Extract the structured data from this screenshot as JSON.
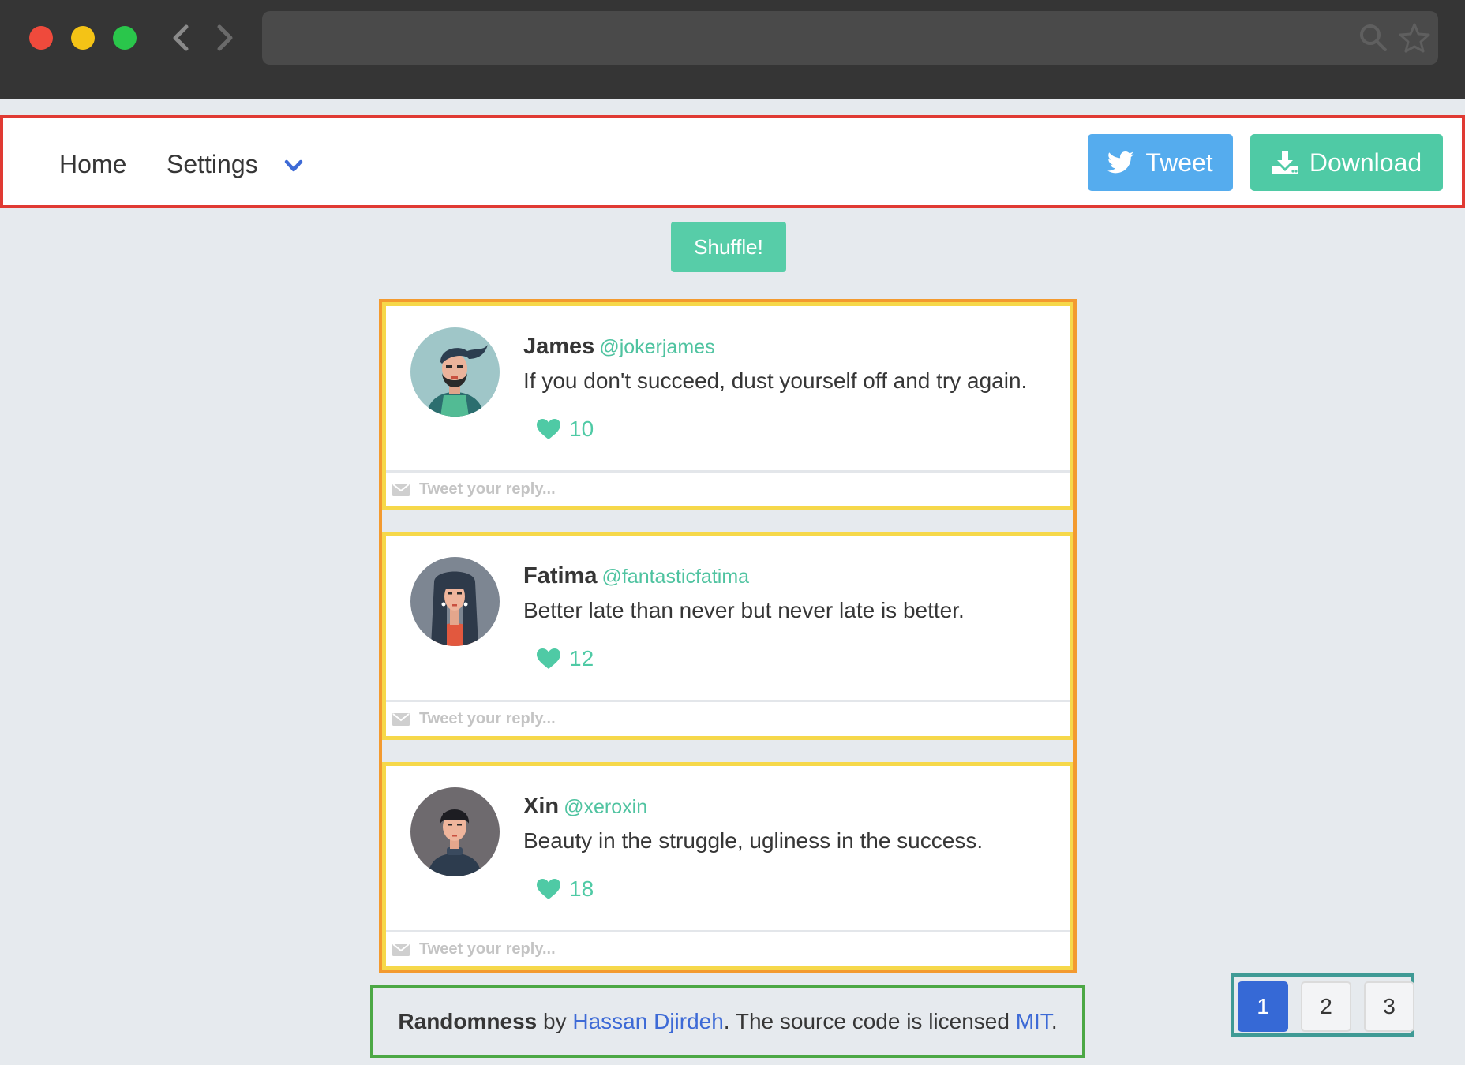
{
  "navbar": {
    "home_label": "Home",
    "settings_label": "Settings",
    "tweet_label": "Tweet",
    "download_label": "Download"
  },
  "shuffle_label": "Shuffle!",
  "tweets": [
    {
      "name": "James",
      "handle": "@jokerjames",
      "text": "If you don't succeed, dust yourself off and try again.",
      "likes": "10",
      "reply_placeholder": "Tweet your reply..."
    },
    {
      "name": "Fatima",
      "handle": "@fantasticfatima",
      "text": "Better late than never but never late is better.",
      "likes": "12",
      "reply_placeholder": "Tweet your reply..."
    },
    {
      "name": "Xin",
      "handle": "@xeroxin",
      "text": "Beauty in the struggle, ugliness in the success.",
      "likes": "18",
      "reply_placeholder": "Tweet your reply..."
    }
  ],
  "footer": {
    "project": "Randomness",
    "by": " by ",
    "author": "Hassan Djirdeh",
    "middle": ". The source code is licensed ",
    "license": "MIT",
    "end": "."
  },
  "pagination": {
    "pages": [
      "1",
      "2",
      "3"
    ],
    "active": "1"
  },
  "colors": {
    "accent_green": "#4fcaa5",
    "twitter_blue": "#55acee",
    "link_blue": "#3d6ad6",
    "active_page": "#3669d6"
  },
  "icons": {
    "tweet_button": "twitter-bird-icon",
    "download_button": "download-icon",
    "settings": "chevron-down-icon",
    "likes": "heart-icon",
    "reply": "envelope-icon"
  }
}
